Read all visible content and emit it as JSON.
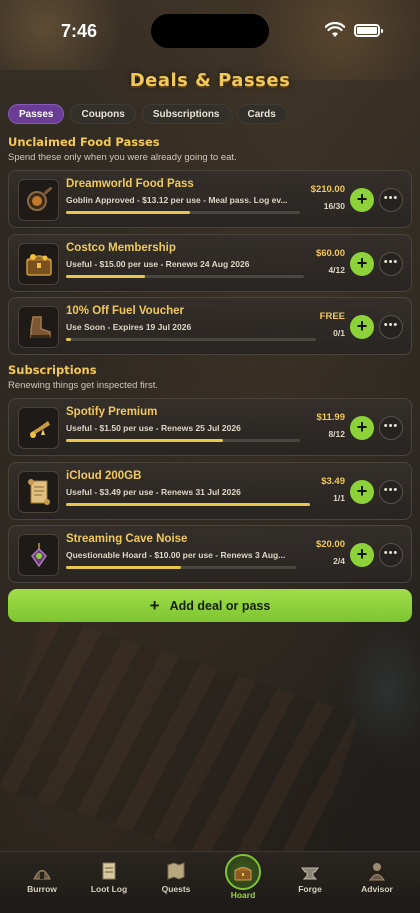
{
  "status_bar": {
    "time": "7:46"
  },
  "header": {
    "title": "Deals & Passes"
  },
  "tabs": [
    {
      "label": "Passes",
      "active": true
    },
    {
      "label": "Coupons",
      "active": false
    },
    {
      "label": "Subscriptions",
      "active": false
    },
    {
      "label": "Cards",
      "active": false
    }
  ],
  "passes_section": {
    "title": "Unclaimed Food Passes",
    "subtitle": "Spend these only when you were already going to eat.",
    "items": [
      {
        "icon": "pan-icon",
        "name": "Dreamworld Food Pass",
        "desc": "Goblin Approved - $13.12 per use - Meal pass. Log ev...",
        "price": "$210.00",
        "count": "16/30",
        "progress": 0.53
      },
      {
        "icon": "treasure-chest-icon",
        "name": "Costco Membership",
        "desc": "Useful - $15.00 per use - Renews 24 Aug 2026",
        "price": "$60.00",
        "count": "4/12",
        "progress": 0.33
      },
      {
        "icon": "boot-icon",
        "name": "10% Off Fuel Voucher",
        "desc": "Use Soon - Expires 19 Jul 2026",
        "price": "FREE",
        "count": "0/1",
        "progress": 0.02
      }
    ]
  },
  "subscriptions_section": {
    "title": "Subscriptions",
    "subtitle": "Renewing things get inspected first.",
    "items": [
      {
        "icon": "music-horn-icon",
        "name": "Spotify Premium",
        "desc": "Useful - $1.50 per use - Renews 25 Jul 2026",
        "price": "$11.99",
        "count": "8/12",
        "progress": 0.67
      },
      {
        "icon": "scroll-icon",
        "name": "iCloud 200GB",
        "desc": "Useful - $3.49 per use - Renews 31 Jul 2026",
        "price": "$3.49",
        "count": "1/1",
        "progress": 1.0
      },
      {
        "icon": "gem-icon",
        "name": "Streaming Cave Noise",
        "desc": "Questionable Hoard - $10.00 per use - Renews 3 Aug...",
        "price": "$20.00",
        "count": "2/4",
        "progress": 0.5
      }
    ]
  },
  "add_button": {
    "label": "Add deal or pass"
  },
  "tab_bar": [
    {
      "label": "Burrow",
      "icon": "burrow-icon",
      "active": false
    },
    {
      "label": "Loot Log",
      "icon": "scroll-log-icon",
      "active": false
    },
    {
      "label": "Quests",
      "icon": "quests-map-icon",
      "active": false
    },
    {
      "label": "Hoard",
      "icon": "hoard-chest-icon",
      "active": true
    },
    {
      "label": "Forge",
      "icon": "anvil-icon",
      "active": false
    },
    {
      "label": "Advisor",
      "icon": "advisor-icon",
      "active": false
    }
  ],
  "colors": {
    "accent_gold": "#f1c85a",
    "accent_green": "#8ed23a",
    "active_tab_purple": "#6a3c94"
  }
}
